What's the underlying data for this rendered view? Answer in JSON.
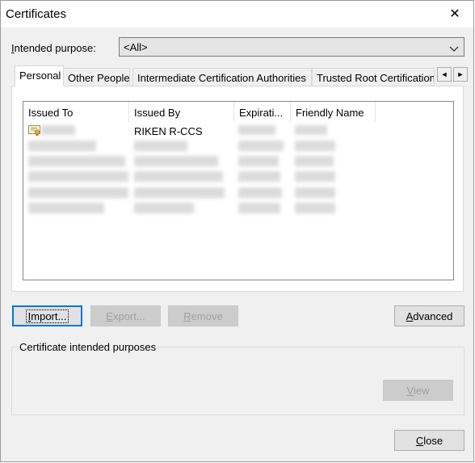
{
  "window": {
    "title": "Certificates",
    "close_label": "✕"
  },
  "purpose": {
    "label_u": "I",
    "label_rest": "ntended purpose:",
    "value": "<All>",
    "chevron": "∨"
  },
  "tabs": [
    {
      "label": "Personal",
      "active": true
    },
    {
      "label": "Other People"
    },
    {
      "label": "Intermediate Certification Authorities"
    },
    {
      "label": "Trusted Root Certification Authorities"
    }
  ],
  "tab_scroll": {
    "left": "◄",
    "right": "►"
  },
  "list": {
    "columns": [
      "Issued To",
      "Issued By",
      "Expirati...",
      "Friendly Name"
    ],
    "rows": [
      {
        "issued_to": "",
        "issued_by": "RIKEN R-CCS",
        "expiration": "",
        "friendly_name": "",
        "icon": "certificate-icon"
      }
    ]
  },
  "buttons": {
    "import": {
      "mn": "I",
      "rest": "mport..."
    },
    "export": {
      "mn": "E",
      "rest": "xport..."
    },
    "remove": {
      "mn": "R",
      "rest": "emove"
    },
    "advanced": {
      "mn": "A",
      "rest": "dvanced"
    },
    "view": {
      "mn": "V",
      "rest": "iew"
    },
    "close": {
      "mn": "C",
      "rest": "lose"
    }
  },
  "purposes_group": {
    "title": "Certificate intended purposes"
  },
  "colors": {
    "accent": "#0078d7",
    "dialog_bg": "#f0f0f0"
  }
}
